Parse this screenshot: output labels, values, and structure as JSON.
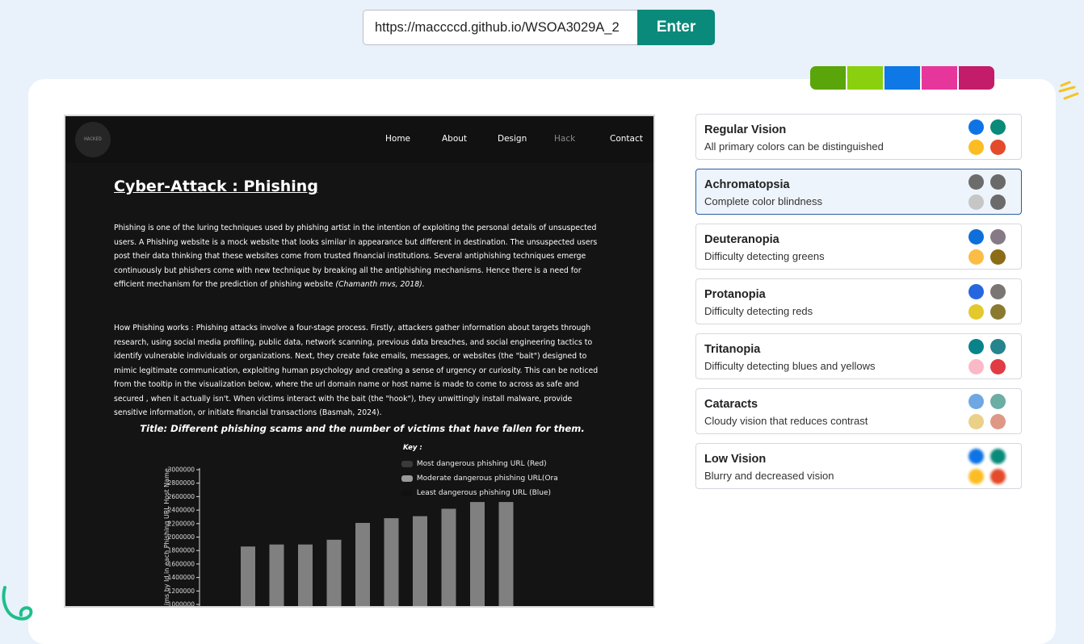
{
  "url_bar": {
    "url": "https://maccccd.github.io/WSOA3029A_2",
    "enter_label": "Enter"
  },
  "palette": [
    "#5aa50a",
    "#8ad00f",
    "#0d78e6",
    "#e7369b",
    "#c31c6a"
  ],
  "site": {
    "logo_text": "HACKED",
    "nav": [
      "Home",
      "About",
      "Design",
      "Hack",
      "Contact"
    ],
    "title": "Cyber-Attack : Phishing",
    "para1": "Phishing is one of the luring techniques used by phishing artist in the intention of exploiting the personal details of unsuspected users. A Phishing website is a mock website that looks similar in appearance but different in destination. The unsuspected users post their data thinking that these websites come from trusted financial institutions. Several antiphishing techniques emerge continuously but phishers come with new technique by breaking all the antiphishing mechanisms. Hence there is a need for efficient mechanism for the prediction of phishing website",
    "para1_citation": "(Chamanth mvs, 2018).",
    "para2": "How Phishing works : Phishing attacks involve a four-stage process. Firstly, attackers gather information about targets through research, using social media profiling, public data, network scanning, previous data breaches, and social engineering tactics to identify vulnerable individuals or organizations. Next, they create fake emails, messages, or websites (the \"bait\") designed to mimic legitimate communication, exploiting human psychology and creating a sense of urgency or curiosity. This can be noticed from the tooltip in the visualization below, where the url domain name or host name is made to come to across as safe and secured , when it actually isn't. When victims interact with the bait (the \"hook\"), they unwittingly install malware, provide sensitive information, or initiate financial transactions (Basmah, 2024)."
  },
  "chart_data": {
    "type": "bar",
    "title": "Title: Different phishing scams and the number of victims that have fallen for them.",
    "ylabel": "ims by Id in each Phishing URL Host Name",
    "legend_title": "Key :",
    "legend": [
      {
        "label": "Most dangerous phishing URL (Red)",
        "color": "#3a3a3a"
      },
      {
        "label": "Moderate dangerous phishing URL(Ora",
        "color": "#9a9a9a"
      },
      {
        "label": "Least dangerous phishing URL (Blue)",
        "color": "#111111"
      }
    ],
    "ylim": [
      1000000,
      3000000
    ],
    "yticks": [
      "3000000",
      "2800000",
      "2600000",
      "2400000",
      "2200000",
      "2000000",
      "1800000",
      "1600000",
      "1400000",
      "1200000",
      "1000000"
    ],
    "values": [
      1860000,
      1890000,
      1890000,
      1960000,
      2210000,
      2280000,
      2310000,
      2420000,
      2520000,
      2520000
    ],
    "bar_color": "#808080"
  },
  "visions": [
    {
      "name": "Regular Vision",
      "desc": "All primary colors can be distinguished",
      "colors": [
        "#0e74e6",
        "#0a8a78",
        "#fbbd23",
        "#e34b2a"
      ],
      "selected": false
    },
    {
      "name": "Achromatopsia",
      "desc": "Complete color blindness",
      "colors": [
        "#6c6c6c",
        "#6a6a6a",
        "#c6c6c6",
        "#6b6b6b"
      ],
      "selected": true
    },
    {
      "name": "Deuteranopia",
      "desc": "Difficulty detecting greens",
      "colors": [
        "#0e6fd9",
        "#857a86",
        "#fbbd45",
        "#8d6c18"
      ],
      "selected": false
    },
    {
      "name": "Protanopia",
      "desc": "Difficulty detecting reds",
      "colors": [
        "#2667e0",
        "#7a7673",
        "#e3c92b",
        "#8a7a30"
      ],
      "selected": false
    },
    {
      "name": "Tritanopia",
      "desc": "Difficulty detecting blues and yellows",
      "colors": [
        "#08838a",
        "#25848c",
        "#fbb9c8",
        "#e03c45"
      ],
      "selected": false
    },
    {
      "name": "Cataracts",
      "desc": "Cloudy vision that reduces contrast",
      "colors": [
        "#6fa7e3",
        "#6aaea4",
        "#ead089",
        "#de9886"
      ],
      "selected": false
    },
    {
      "name": "Low Vision",
      "desc": "Blurry and decreased vision",
      "colors": [
        "#0e74e6",
        "#0a8a78",
        "#fbbd23",
        "#e34b2a"
      ],
      "selected": false,
      "blurred": true
    }
  ]
}
